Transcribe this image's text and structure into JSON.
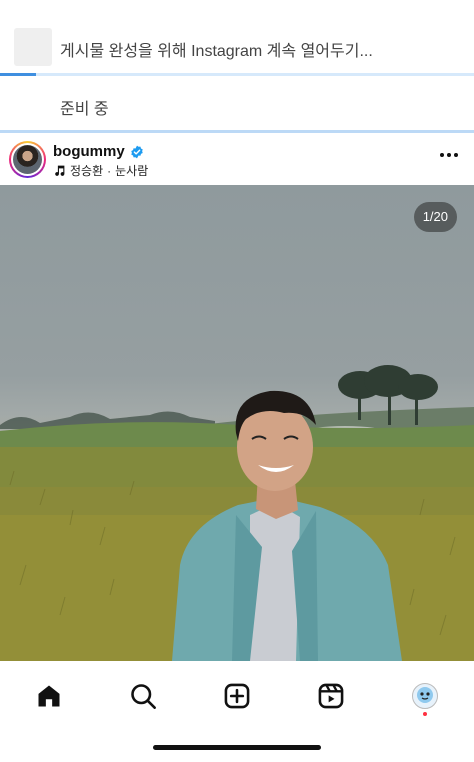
{
  "upload": {
    "status_text": "게시물 완성을 위해 Instagram 계속 열어두기...",
    "progress": 0.075
  },
  "pending": {
    "status_text": "준비 중"
  },
  "post": {
    "username": "bogummy",
    "verified": true,
    "music": {
      "artist": "정승환",
      "separator": "·",
      "song": "눈사람"
    },
    "carousel_counter": "1/20"
  },
  "nav": {
    "items": [
      {
        "icon": "home-icon",
        "active": true
      },
      {
        "icon": "search-icon"
      },
      {
        "icon": "create-icon"
      },
      {
        "icon": "reels-icon"
      },
      {
        "icon": "profile-avatar",
        "has_notification": true
      }
    ]
  },
  "colors": {
    "accent": "#3f8fe0",
    "verified": "#1d9bf0",
    "notification": "#ff3040"
  }
}
